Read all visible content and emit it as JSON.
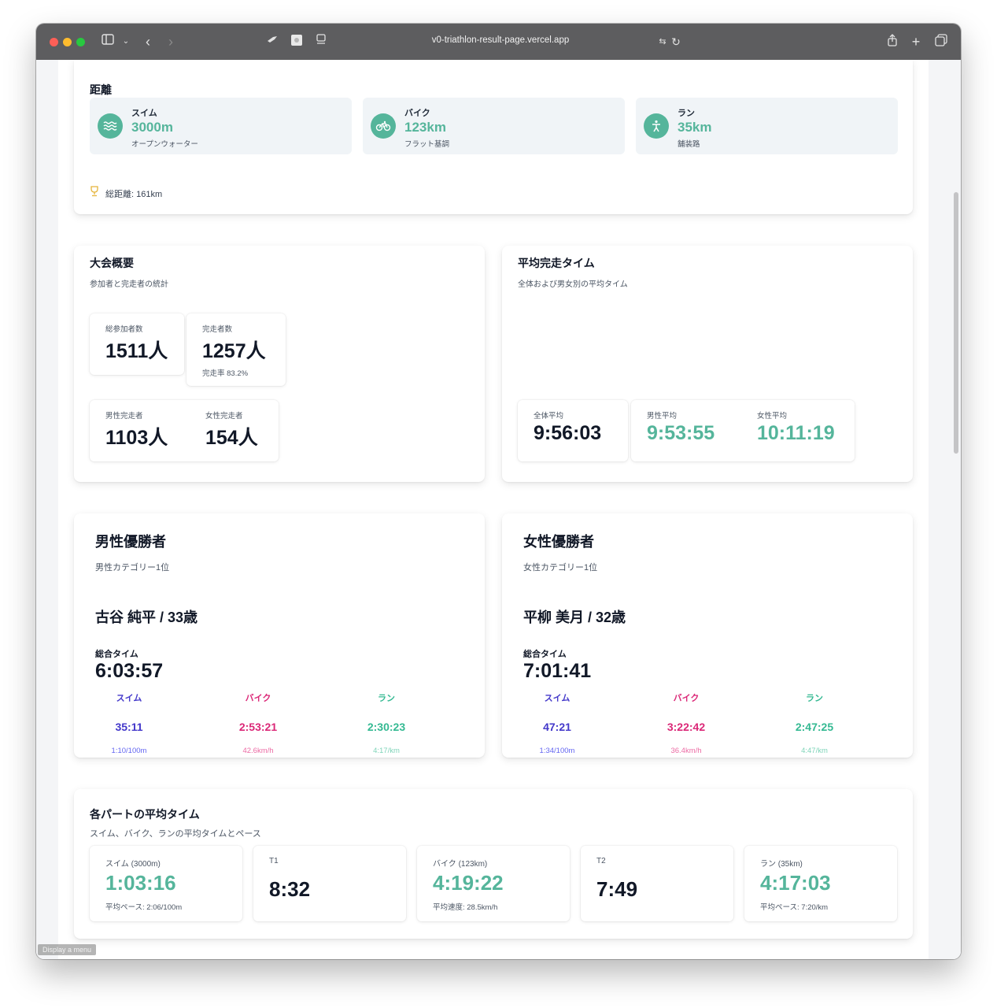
{
  "browser": {
    "url": "v0-triathlon-result-page.vercel.app",
    "menu_hint": "Display a menu"
  },
  "colors": {
    "accent": "#55b59b",
    "swim": "#4338ca",
    "bike": "#db2777",
    "run": "#34b992"
  },
  "distance": {
    "title": "距離",
    "items": [
      {
        "name": "スイム",
        "value": "3000m",
        "note": "オープンウォーター",
        "icon": "waves-icon"
      },
      {
        "name": "バイク",
        "value": "123km",
        "note": "フラット基調",
        "icon": "bicycle-icon"
      },
      {
        "name": "ラン",
        "value": "35km",
        "note": "舗装路",
        "icon": "runner-icon"
      }
    ],
    "total": "総距離: 161km",
    "total_icon": "trophy-icon"
  },
  "overview": {
    "title": "大会概要",
    "subtitle": "参加者と完走者の統計",
    "participants_label": "総参加者数",
    "participants": "1511人",
    "finishers_label": "完走者数",
    "finishers": "1257人",
    "finish_rate": "完走率 83.2%",
    "male_label": "男性完走者",
    "male": "1103人",
    "female_label": "女性完走者",
    "female": "154人"
  },
  "avg_finish": {
    "title": "平均完走タイム",
    "subtitle": "全体および男女別の平均タイム",
    "overall_label": "全体平均",
    "overall": "9:56:03",
    "male_label": "男性平均",
    "male": "9:53:55",
    "female_label": "女性平均",
    "female": "10:11:19"
  },
  "male_winner": {
    "title": "男性優勝者",
    "subtitle": "男性カテゴリー1位",
    "name": "古谷 純平 / 33歳",
    "total_label": "総合タイム",
    "total": "6:03:57",
    "swim": {
      "label": "スイム",
      "time": "35:11",
      "pace": "1:10/100m"
    },
    "bike": {
      "label": "バイク",
      "time": "2:53:21",
      "pace": "42.6km/h"
    },
    "run": {
      "label": "ラン",
      "time": "2:30:23",
      "pace": "4:17/km"
    }
  },
  "female_winner": {
    "title": "女性優勝者",
    "subtitle": "女性カテゴリー1位",
    "name": "平柳 美月 / 32歳",
    "total_label": "総合タイム",
    "total": "7:01:41",
    "swim": {
      "label": "スイム",
      "time": "47:21",
      "pace": "1:34/100m"
    },
    "bike": {
      "label": "バイク",
      "time": "3:22:42",
      "pace": "36.4km/h"
    },
    "run": {
      "label": "ラン",
      "time": "2:47:25",
      "pace": "4:47/km"
    }
  },
  "part_avg": {
    "title": "各パートの平均タイム",
    "subtitle": "スイム、バイク、ランの平均タイムとペース",
    "swim_label": "スイム (3000m)",
    "swim": "1:03:16",
    "swim_note": "平均ペース: 2:06/100m",
    "t1_label": "T1",
    "t1": "8:32",
    "bike_label": "バイク (123km)",
    "bike": "4:19:22",
    "bike_note": "平均速度: 28.5km/h",
    "t2_label": "T2",
    "t2": "7:49",
    "run_label": "ラン (35km)",
    "run": "4:17:03",
    "run_note": "平均ペース: 7:20/km"
  }
}
